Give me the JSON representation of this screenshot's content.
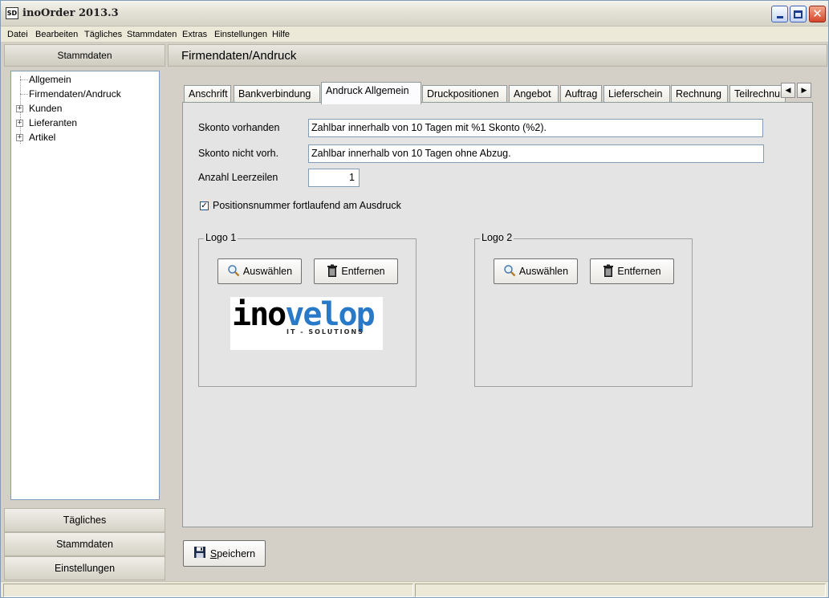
{
  "window": {
    "title": "inoOrder 2013.3",
    "icon_label": "SD"
  },
  "menu": [
    "Datei",
    "Bearbeiten",
    "Tägliches",
    "Stammdaten",
    "Extras",
    "Einstellungen",
    "Hilfe"
  ],
  "left": {
    "header": "Stammdaten",
    "tree": [
      {
        "label": "Allgemein",
        "expandable": false
      },
      {
        "label": "Firmendaten/Andruck",
        "expandable": false
      },
      {
        "label": "Kunden",
        "expandable": true
      },
      {
        "label": "Lieferanten",
        "expandable": true
      },
      {
        "label": "Artikel",
        "expandable": true
      }
    ],
    "buttons": [
      "Tägliches",
      "Stammdaten",
      "Einstellungen"
    ]
  },
  "main": {
    "title": "Firmendaten/Andruck",
    "tabs": [
      "Anschrift",
      "Bankverbindung",
      "Andruck Allgemein",
      "Druckpositionen",
      "Angebot",
      "Auftrag",
      "Lieferschein",
      "Rechnung",
      "Teilrechnung"
    ],
    "active_tab": "Andruck Allgemein",
    "fields": {
      "skonto_vorhanden": {
        "label": "Skonto vorhanden",
        "value": "Zahlbar innerhalb von 10 Tagen mit %1 Skonto (%2)."
      },
      "skonto_nicht": {
        "label": "Skonto nicht vorh.",
        "value": "Zahlbar innerhalb von 10 Tagen ohne Abzug."
      },
      "leerzeilen": {
        "label": "Anzahl Leerzeilen",
        "value": "1"
      }
    },
    "checkbox": {
      "label": "Positionsnummer fortlaufend am Ausdruck",
      "checked": true
    },
    "logo1": {
      "title": "Logo 1",
      "select": "Auswählen",
      "remove": "Entfernen",
      "image": {
        "word_black": "ino",
        "word_blue": "velop",
        "tagline": "IT - SOLUTIONS"
      }
    },
    "logo2": {
      "title": "Logo 2",
      "select": "Auswählen",
      "remove": "Entfernen"
    },
    "save": {
      "underlined": "S",
      "rest": "peichern"
    }
  },
  "colors": {
    "logo_blue": "#2979c9",
    "window_bg": "#d4d0c8"
  }
}
